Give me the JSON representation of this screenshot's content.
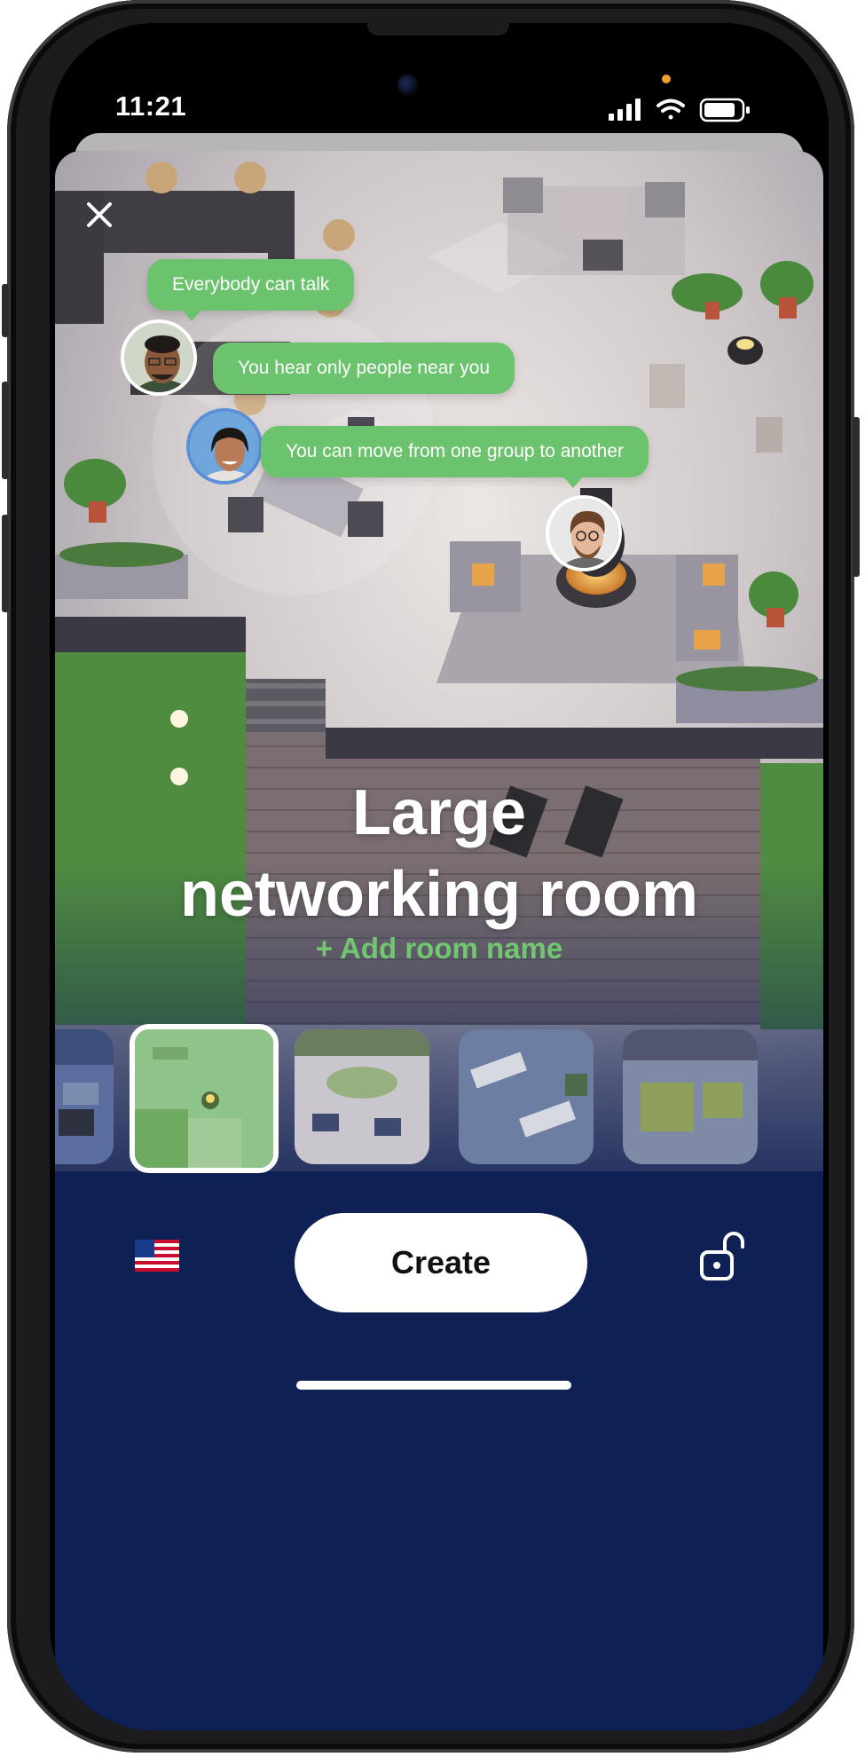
{
  "status_bar": {
    "time": "11:21"
  },
  "room": {
    "title_line1": "Large",
    "title_line2": "networking room",
    "add_name_label": "+ Add room name"
  },
  "bubbles": {
    "b1": "Everybody can talk",
    "b2": "You hear only people near you",
    "b3": "You can move from one group to another"
  },
  "footer": {
    "create_label": "Create"
  },
  "colors": {
    "accent_green": "#72c66f",
    "bubble_green": "#6cc36e",
    "background_navy": "#0f2054"
  },
  "icons": [
    "close-icon",
    "flag-us-icon",
    "unlock-icon",
    "cellular-signal-icon",
    "wifi-icon",
    "battery-icon"
  ]
}
